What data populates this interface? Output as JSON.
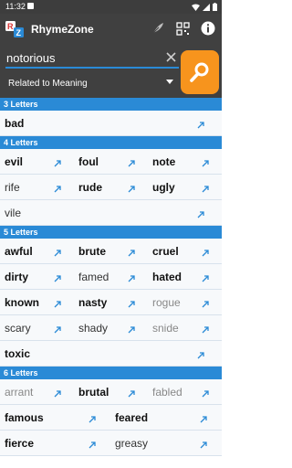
{
  "status": {
    "time": "11:32"
  },
  "app": {
    "brand": "RhymeZone"
  },
  "search": {
    "query": "notorious",
    "mode": "Related to Meaning"
  },
  "colors": {
    "accent_blue": "#2a8ad6",
    "search_orange": "#f7941d",
    "appbar": "#404040"
  },
  "sections": [
    {
      "title": "3 Letters",
      "rows": [
        [
          {
            "word": "bad",
            "weight": "bold"
          }
        ]
      ]
    },
    {
      "title": "4 Letters",
      "rows": [
        [
          {
            "word": "evil",
            "weight": "bold"
          },
          {
            "word": "foul",
            "weight": "bold"
          },
          {
            "word": "note",
            "weight": "bold"
          }
        ],
        [
          {
            "word": "rife",
            "weight": "normal"
          },
          {
            "word": "rude",
            "weight": "bold"
          },
          {
            "word": "ugly",
            "weight": "bold"
          }
        ],
        [
          {
            "word": "vile",
            "weight": "normal"
          }
        ]
      ]
    },
    {
      "title": "5 Letters",
      "rows": [
        [
          {
            "word": "awful",
            "weight": "bold"
          },
          {
            "word": "brute",
            "weight": "bold"
          },
          {
            "word": "cruel",
            "weight": "bold"
          }
        ],
        [
          {
            "word": "dirty",
            "weight": "bold"
          },
          {
            "word": "famed",
            "weight": "normal"
          },
          {
            "word": "hated",
            "weight": "bold"
          }
        ],
        [
          {
            "word": "known",
            "weight": "bold"
          },
          {
            "word": "nasty",
            "weight": "bold"
          },
          {
            "word": "rogue",
            "weight": "light"
          }
        ],
        [
          {
            "word": "scary",
            "weight": "normal"
          },
          {
            "word": "shady",
            "weight": "normal"
          },
          {
            "word": "snide",
            "weight": "light"
          }
        ],
        [
          {
            "word": "toxic",
            "weight": "bold"
          }
        ]
      ]
    },
    {
      "title": "6 Letters",
      "rows": [
        [
          {
            "word": "arrant",
            "weight": "light"
          },
          {
            "word": "brutal",
            "weight": "bold"
          },
          {
            "word": "fabled",
            "weight": "light"
          }
        ],
        [
          {
            "word": "famous",
            "weight": "bold"
          },
          {
            "word": "feared",
            "weight": "bold"
          }
        ],
        [
          {
            "word": "fierce",
            "weight": "bold"
          },
          {
            "word": "greasy",
            "weight": "normal"
          }
        ]
      ]
    }
  ]
}
